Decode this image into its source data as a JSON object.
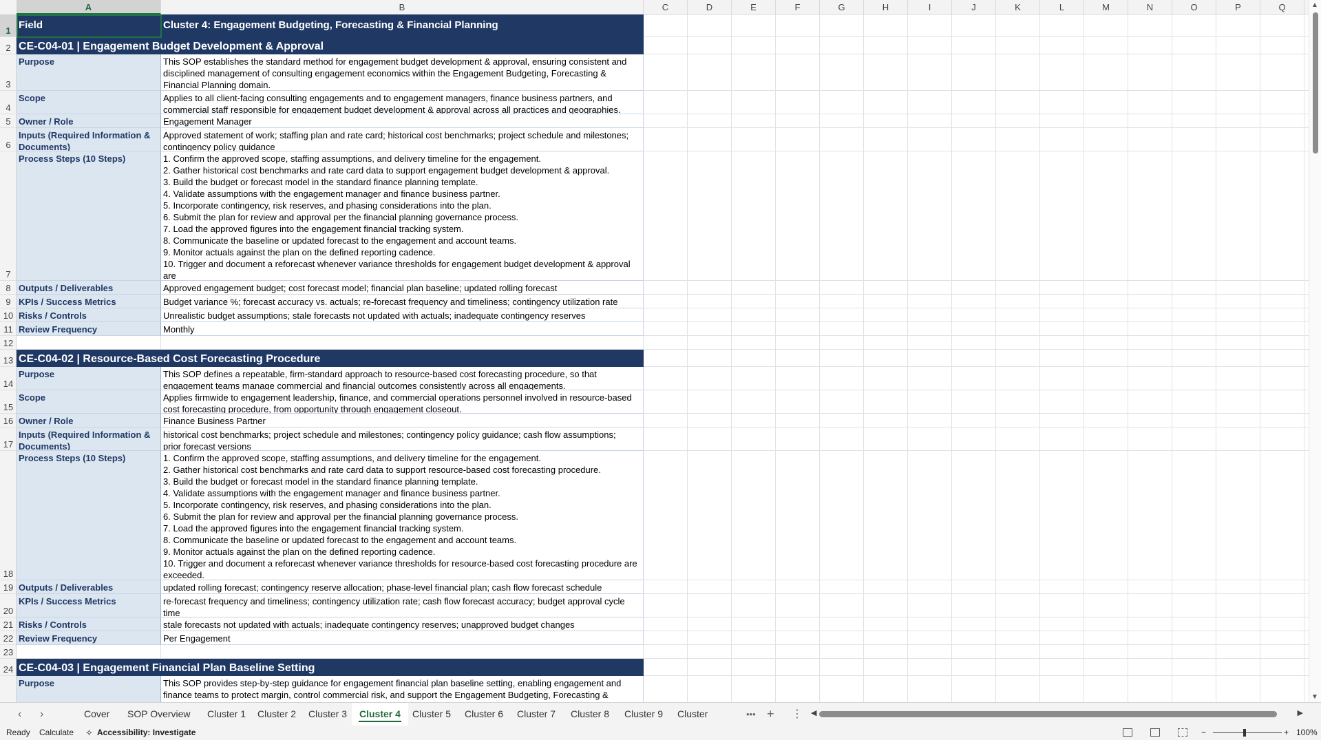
{
  "columns": [
    "A",
    "B",
    "C",
    "D",
    "E",
    "F",
    "G",
    "H",
    "I",
    "J",
    "K",
    "L",
    "M",
    "N",
    "O",
    "P",
    "Q"
  ],
  "sheet": {
    "header": {
      "field": "Field",
      "title": "Cluster 4: Engagement Budgeting, Forecasting & Financial Planning"
    },
    "sections": [
      {
        "title": "CE-C04-01  |  Engagement Budget Development & Approval",
        "rows": [
          {
            "field": "Purpose",
            "value": "This SOP establishes the standard method for engagement budget development & approval, ensuring consistent and\ndisciplined management of consulting engagement economics within the Engagement Budgeting, Forecasting &\nFinancial Planning domain."
          },
          {
            "field": "Scope",
            "value": "Applies to all client-facing consulting engagements and to engagement managers, finance business partners, and\ncommercial staff responsible for engagement budget development & approval across all practices and geographies."
          },
          {
            "field": "Owner / Role",
            "value": "Engagement Manager"
          },
          {
            "field": "Inputs (Required Information &\nDocuments)",
            "value": "Approved statement of work; staffing plan and rate card; historical cost benchmarks; project schedule and milestones;\ncontingency policy guidance"
          },
          {
            "field": "Process Steps (10 Steps)",
            "value": "1. Confirm the approved scope, staffing assumptions, and delivery timeline for the engagement.\n2. Gather historical cost benchmarks and rate card data to support engagement budget development & approval.\n3. Build the budget or forecast model in the standard finance planning template.\n4. Validate assumptions with the engagement manager and finance business partner.\n5. Incorporate contingency, risk reserves, and phasing considerations into the plan.\n6. Submit the plan for review and approval per the financial planning governance process.\n7. Load the approved figures into the engagement financial tracking system.\n8. Communicate the baseline or updated forecast to the engagement and account teams.\n9. Monitor actuals against the plan on the defined reporting cadence.\n10. Trigger and document a reforecast whenever variance thresholds for engagement budget development & approval are\nexceeded."
          },
          {
            "field": "Outputs / Deliverables",
            "value": "Approved engagement budget; cost forecast model; financial plan baseline; updated rolling forecast"
          },
          {
            "field": "KPIs / Success Metrics",
            "value": "Budget variance %; forecast accuracy vs. actuals; re-forecast frequency and timeliness; contingency utilization rate"
          },
          {
            "field": "Risks / Controls",
            "value": "Unrealistic budget assumptions; stale forecasts not updated with actuals; inadequate contingency reserves"
          },
          {
            "field": "Review Frequency",
            "value": "Monthly"
          }
        ]
      },
      {
        "title": "CE-C04-02  |  Resource-Based Cost Forecasting Procedure",
        "rows": [
          {
            "field": "Purpose",
            "value": "This SOP defines a repeatable, firm-standard approach to resource-based cost forecasting procedure, so that\nengagement teams manage commercial and financial outcomes consistently across all engagements."
          },
          {
            "field": "Scope",
            "value": "Applies firmwide to engagement leadership, finance, and commercial operations personnel involved in resource-based\ncost forecasting procedure, from opportunity through engagement closeout."
          },
          {
            "field": "Owner / Role",
            "value": "Finance Business Partner"
          },
          {
            "field": "Inputs (Required Information &\nDocuments)",
            "value": "historical cost benchmarks; project schedule and milestones; contingency policy guidance; cash flow assumptions;\nprior forecast versions"
          },
          {
            "field": "Process Steps (10 Steps)",
            "value": "1. Confirm the approved scope, staffing assumptions, and delivery timeline for the engagement.\n2. Gather historical cost benchmarks and rate card data to support resource-based cost forecasting procedure.\n3. Build the budget or forecast model in the standard finance planning template.\n4. Validate assumptions with the engagement manager and finance business partner.\n5. Incorporate contingency, risk reserves, and phasing considerations into the plan.\n6. Submit the plan for review and approval per the financial planning governance process.\n7. Load the approved figures into the engagement financial tracking system.\n8. Communicate the baseline or updated forecast to the engagement and account teams.\n9. Monitor actuals against the plan on the defined reporting cadence.\n10. Trigger and document a reforecast whenever variance thresholds for resource-based cost forecasting procedure are\nexceeded."
          },
          {
            "field": "Outputs / Deliverables",
            "value": "updated rolling forecast; contingency reserve allocation; phase-level financial plan; cash flow forecast schedule"
          },
          {
            "field": "KPIs / Success Metrics",
            "value": "re-forecast frequency and timeliness; contingency utilization rate; cash flow forecast accuracy; budget approval cycle\ntime"
          },
          {
            "field": "Risks / Controls",
            "value": "stale forecasts not updated with actuals; inadequate contingency reserves; unapproved budget changes"
          },
          {
            "field": "Review Frequency",
            "value": "Per Engagement"
          }
        ]
      },
      {
        "title": "CE-C04-03  |  Engagement Financial Plan Baseline Setting",
        "rows": [
          {
            "field": "Purpose",
            "value": "This SOP provides step-by-step guidance for engagement financial plan baseline setting, enabling engagement and\nfinance teams to protect margin, control commercial risk, and support the Engagement Budgeting, Forecasting &\nFinancial Planning objectives."
          }
        ]
      }
    ]
  },
  "tabs": [
    "Cover",
    "SOP Overview",
    "Cluster 1",
    "Cluster 2",
    "Cluster 3",
    "Cluster 4",
    "Cluster 5",
    "Cluster 6",
    "Cluster 7",
    "Cluster 8",
    "Cluster 9",
    "Cluster"
  ],
  "active_tab": "Cluster 4",
  "tab_more": "•••",
  "tab_add": "+",
  "tab_menu": "⋮",
  "status": {
    "ready": "Ready",
    "calculate": "Calculate",
    "accessibility": "Accessibility: Investigate",
    "zoom": "100%",
    "zoom_minus": "−",
    "zoom_plus": "+"
  },
  "colors": {
    "header_fill": "#1f3864",
    "field_fill": "#dce6f1",
    "accent": "#217346"
  }
}
